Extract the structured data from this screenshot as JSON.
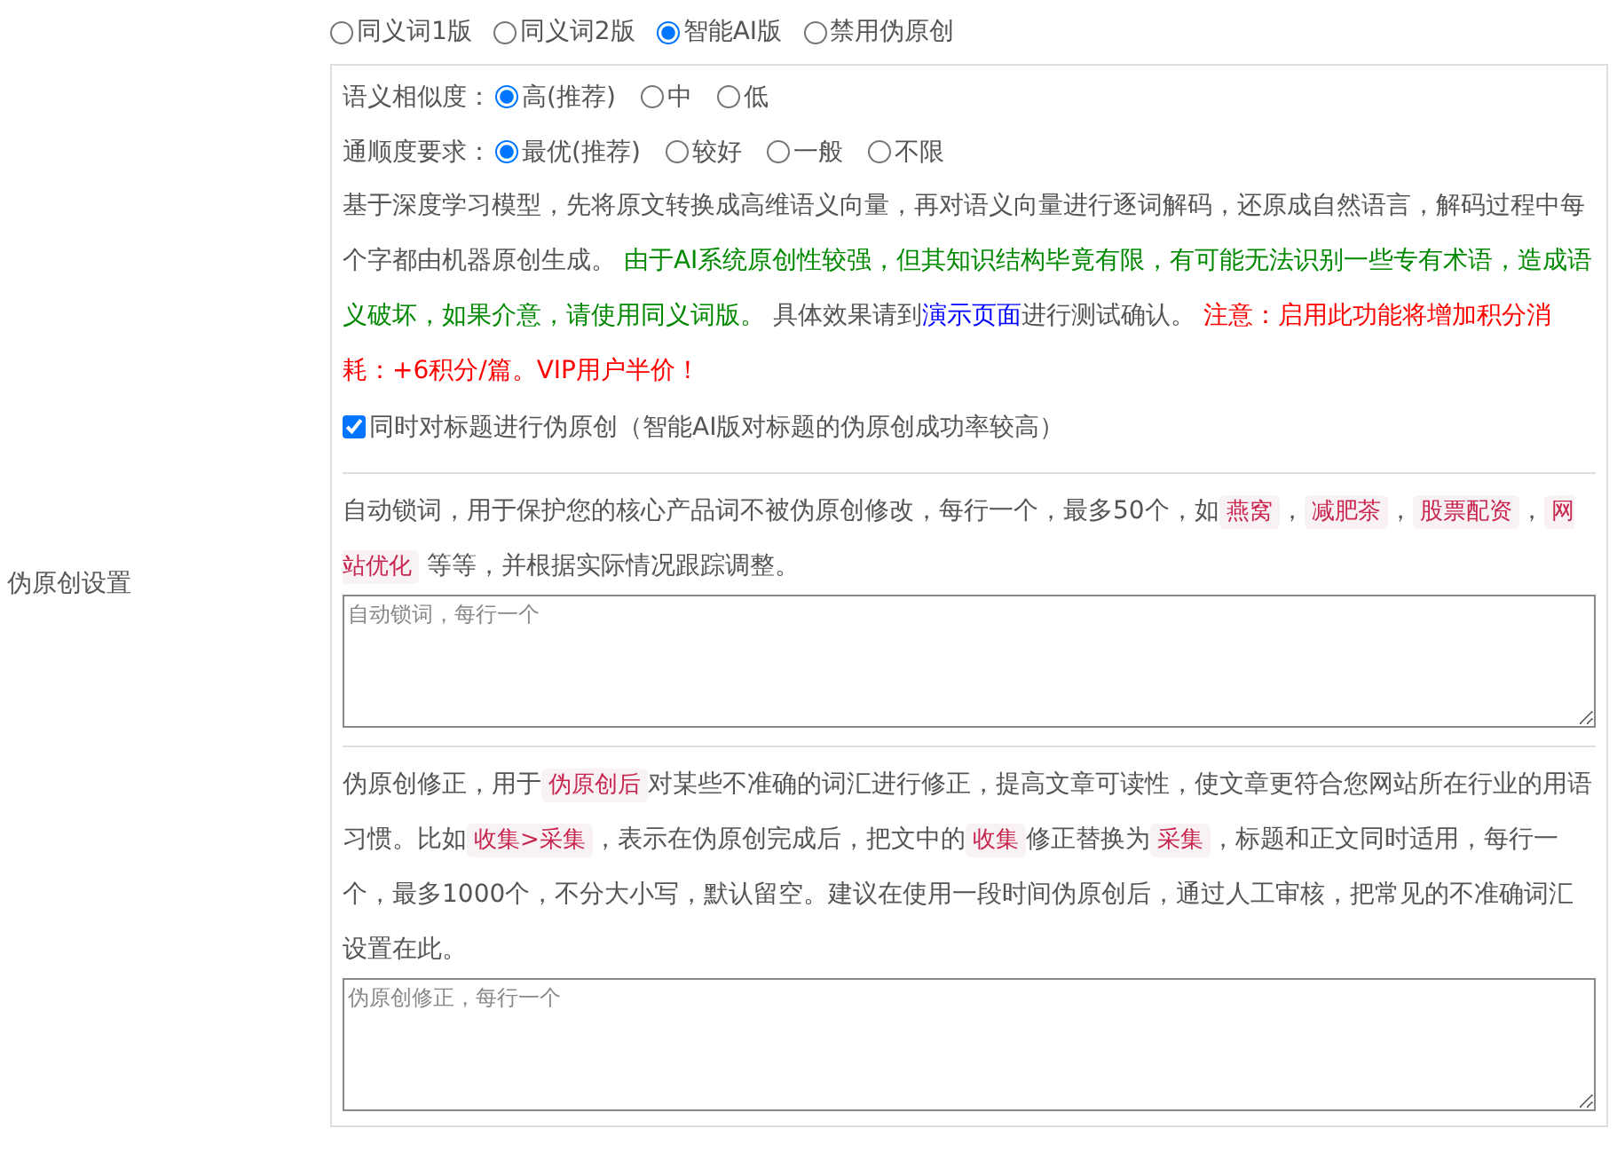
{
  "label": "伪原创设置",
  "modes": [
    {
      "label": "同义词1版",
      "selected": false
    },
    {
      "label": "同义词2版",
      "selected": false
    },
    {
      "label": "智能AI版",
      "selected": true
    },
    {
      "label": "禁用伪原创",
      "selected": false
    }
  ],
  "similarity": {
    "label": "语义相似度：",
    "options": [
      {
        "label": "高(推荐)",
        "selected": true
      },
      {
        "label": "中",
        "selected": false
      },
      {
        "label": "低",
        "selected": false
      }
    ]
  },
  "fluency": {
    "label": "通顺度要求：",
    "options": [
      {
        "label": "最优(推荐)",
        "selected": true
      },
      {
        "label": "较好",
        "selected": false
      },
      {
        "label": "一般",
        "selected": false
      },
      {
        "label": "不限",
        "selected": false
      }
    ]
  },
  "ai_note": [
    {
      "kind": "plain",
      "text": "基于深度学习模型，先将原文转换成高维语义向量，再对语义向量进行逐词解码，还原成自然语言，解码过程中每个字都由机器原创生成。 "
    },
    {
      "kind": "green",
      "text": "由于AI系统原创性较强，但其知识结构毕竟有限，有可能无法识别一些专有术语，造成语义破坏，如果介意，请使用同义词版。"
    },
    {
      "kind": "plain",
      "text": " 具体效果请到"
    },
    {
      "kind": "link",
      "text": "演示页面"
    },
    {
      "kind": "plain",
      "text": "进行测试确认。 "
    },
    {
      "kind": "red",
      "text": "注意：启用此功能将增加积分消耗：+6积分/篇。VIP用户半价！"
    }
  ],
  "title_option": {
    "label": "同时对标题进行伪原创（智能AI版对标题的伪原创成功率较高）",
    "checked": true
  },
  "lock_words": {
    "description": [
      {
        "kind": "plain",
        "text": "自动锁词，用于保护您的核心产品词不被伪原创修改，每行一个，最多50个，如"
      },
      {
        "kind": "code",
        "text": "燕窝"
      },
      {
        "kind": "plain",
        "text": "，"
      },
      {
        "kind": "code",
        "text": "减肥茶"
      },
      {
        "kind": "plain",
        "text": "，"
      },
      {
        "kind": "code",
        "text": "股票配资"
      },
      {
        "kind": "plain",
        "text": "，"
      },
      {
        "kind": "code",
        "text": "网站优化"
      },
      {
        "kind": "plain",
        "text": " 等等，并根据实际情况跟踪调整。"
      }
    ],
    "placeholder": "自动锁词，每行一个"
  },
  "corrections": {
    "description": [
      {
        "kind": "plain",
        "text": "伪原创修正，用于"
      },
      {
        "kind": "code",
        "text": "伪原创后"
      },
      {
        "kind": "plain",
        "text": "对某些不准确的词汇进行修正，提高文章可读性，使文章更符合您网站所在行业的用语习惯。比如"
      },
      {
        "kind": "code",
        "text": "收集>采集"
      },
      {
        "kind": "plain",
        "text": "，表示在伪原创完成后，把文中的"
      },
      {
        "kind": "code",
        "text": "收集"
      },
      {
        "kind": "plain",
        "text": "修正替换为"
      },
      {
        "kind": "code",
        "text": "采集"
      },
      {
        "kind": "plain",
        "text": "，标题和正文同时适用，每行一个，最多1000个，不分大小写，默认留空。建议在使用一段时间伪原创后，通过人工审核，把常见的不准确词汇设置在此。"
      }
    ],
    "placeholder": "伪原创修正，每行一个"
  }
}
